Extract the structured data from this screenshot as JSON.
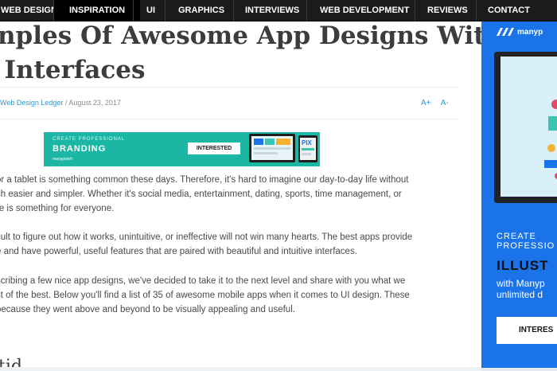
{
  "nav": {
    "items": [
      {
        "label": "WEB DESIGN",
        "active": false
      },
      {
        "label": "INSPIRATION",
        "active": true
      },
      {
        "label": "UI",
        "active": false
      },
      {
        "label": "GRAPHICS",
        "active": false
      },
      {
        "label": "INTERVIEWS",
        "active": false
      },
      {
        "label": "WEB DEVELOPMENT",
        "active": false
      },
      {
        "label": "REVIEWS",
        "active": false
      },
      {
        "label": "CONTACT",
        "active": false
      }
    ]
  },
  "article": {
    "title_line1": "nples Of Awesome App Designs With",
    "title_line2": "e Interfaces",
    "author": "Web Design Ledger",
    "date": " / August 23, 2017",
    "font_increase": "A+",
    "font_decrease": "A-",
    "paragraphs": [
      [
        "or a tablet is something common these days. Therefore, it's hard to imagine our day-to-day life without",
        "ch easier and simpler. Whether it's social media, entertainment, dating, sports, time management,  or",
        "re is something for everyone."
      ],
      [
        "cult to figure out how it works, unintuitive, or ineffective will not win many hearts. The best apps provide",
        "e and have powerful, useful features that are paired with beautiful and intuitive interfaces."
      ],
      [
        "scribing a few nice app designs, we've decided to take it to the next level and share with you what we",
        "st of the best. Below you'll find a list of 35 of awesome mobile apps when it comes to UI design. These",
        "because they went above and beyond to be visually appealing and useful."
      ]
    ],
    "subheading": "tid"
  },
  "banner_ad": {
    "small_text": "CREATE PROFESSIONAL",
    "big_text": "BRANDING",
    "brand": "manypixels",
    "button": "INTERESTED",
    "accent": "#1cb7a4"
  },
  "sidebar_ad": {
    "logo": "manyp",
    "line1": "CREATE",
    "line2": "PROFESSIO",
    "line3": "ILLUST",
    "line4": "with Manyp",
    "line5": "unlimited d",
    "button": "INTERES",
    "accent": "#1a73e8"
  },
  "colors": {
    "nav_bg": "#1b1b1b",
    "link": "#2a9ad3",
    "text": "#4a4a4a"
  }
}
